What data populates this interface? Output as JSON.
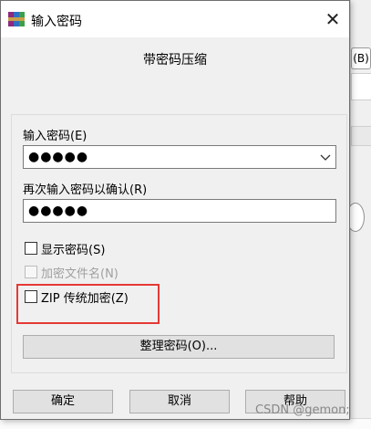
{
  "dialog": {
    "title": "输入密码",
    "close_glyph": "✕",
    "heading": "带密码压缩",
    "enter_label": "输入密码(E)",
    "enter_value": "●●●●●",
    "confirm_label": "再次输入密码以确认(R)",
    "confirm_value": "●●●●●",
    "show_password_label": "显示密码(S)",
    "encrypt_names_label": "加密文件名(N)",
    "zip_legacy_label": "ZIP 传统加密(Z)",
    "organize_button": "整理密码(O)...",
    "ok_button": "确定",
    "cancel_button": "取消",
    "help_button": "帮助"
  },
  "background": {
    "b_button": "(B)"
  },
  "watermark": "CSDN @gemon;",
  "colors": {
    "highlight": "#e53935",
    "window_bg": "#f0f0f0",
    "button_bg": "#e1e1e1"
  },
  "icons": [
    "winrar-app-icon",
    "close-icon",
    "chevron-down-icon"
  ]
}
